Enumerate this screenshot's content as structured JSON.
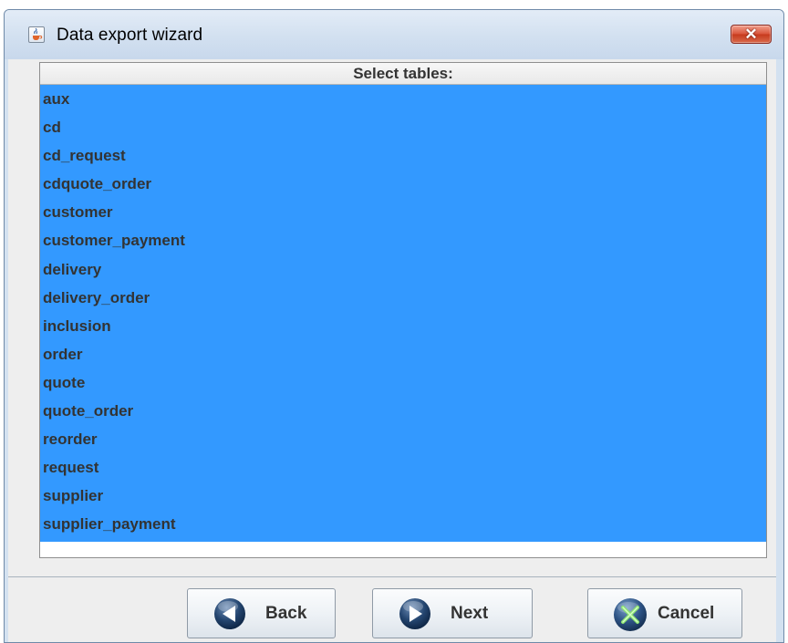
{
  "window": {
    "title": "Data export wizard",
    "app_icon": "java-cup-icon",
    "close_icon": "close-icon",
    "close_label": "✕"
  },
  "list": {
    "header": "Select tables:",
    "selection_color": "#3399ff",
    "items": [
      {
        "label": "aux",
        "selected": true
      },
      {
        "label": "cd",
        "selected": true
      },
      {
        "label": "cd_request",
        "selected": true
      },
      {
        "label": "cdquote_order",
        "selected": true
      },
      {
        "label": "customer",
        "selected": true
      },
      {
        "label": "customer_payment",
        "selected": true
      },
      {
        "label": "delivery",
        "selected": true
      },
      {
        "label": "delivery_order",
        "selected": true
      },
      {
        "label": "inclusion",
        "selected": true
      },
      {
        "label": "order",
        "selected": true
      },
      {
        "label": "quote",
        "selected": true
      },
      {
        "label": "quote_order",
        "selected": true
      },
      {
        "label": "reorder",
        "selected": true
      },
      {
        "label": "request",
        "selected": true
      },
      {
        "label": "supplier",
        "selected": true
      },
      {
        "label": "supplier_payment",
        "selected": true
      }
    ]
  },
  "buttons": {
    "back": {
      "label": "Back",
      "icon": "arrow-left-icon"
    },
    "next": {
      "label": "Next",
      "icon": "arrow-right-icon"
    },
    "cancel": {
      "label": "Cancel",
      "icon": "cancel-x-icon"
    }
  }
}
